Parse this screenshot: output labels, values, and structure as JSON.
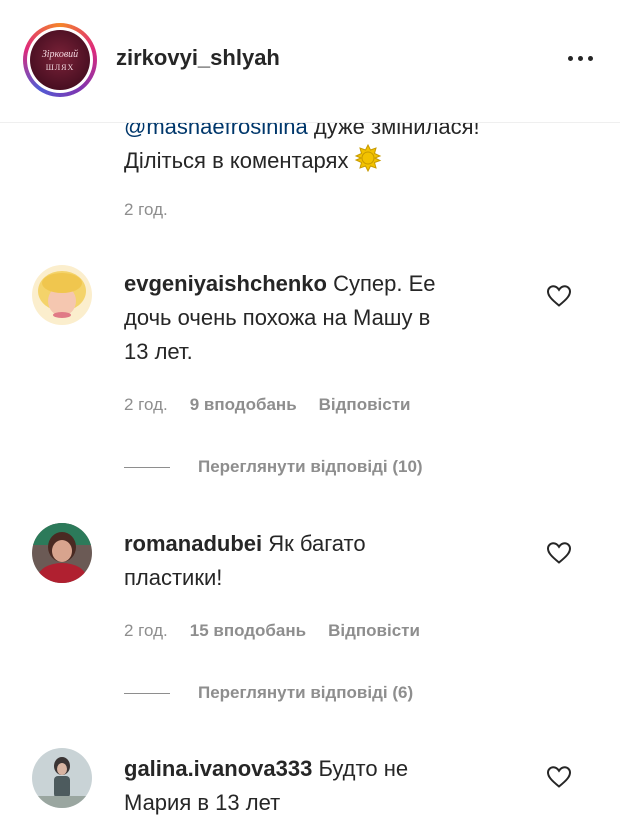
{
  "header": {
    "username": "zirkovyi_shlyah",
    "avatar_logo": {
      "line1": "Зірковий",
      "line2": "ШЛЯХ"
    }
  },
  "caption": {
    "mention": "@mashaefrosinina",
    "text_after_mention": " дуже змінилася!",
    "line2": "Діліться в коментарях",
    "time": "2 год."
  },
  "comments": [
    {
      "username": "evgeniyaishchenko",
      "line1": "Супер. Ее",
      "line2": "дочь очень похожа на Машу в",
      "line3": "13 лет.",
      "time": "2 год.",
      "likes": "9 вподобань",
      "reply": "Відповісти",
      "view_replies": "Переглянути відповіді (10)"
    },
    {
      "username": "romanadubei",
      "line1": "Як багато",
      "line2": "пластики!",
      "time": "2 год.",
      "likes": "15 вподобань",
      "reply": "Відповісти",
      "view_replies": "Переглянути відповіді (6)"
    },
    {
      "username": "galina.ivanova333",
      "line1": "Будто не",
      "line2": "Мария в 13 лет"
    }
  ],
  "icons": {
    "more": "more-options-icon",
    "like": "heart-icon",
    "emoji": "sun-emoji-icon"
  },
  "colors": {
    "text": "#262626",
    "secondary": "#8e8e8e",
    "mention": "#00376b"
  }
}
